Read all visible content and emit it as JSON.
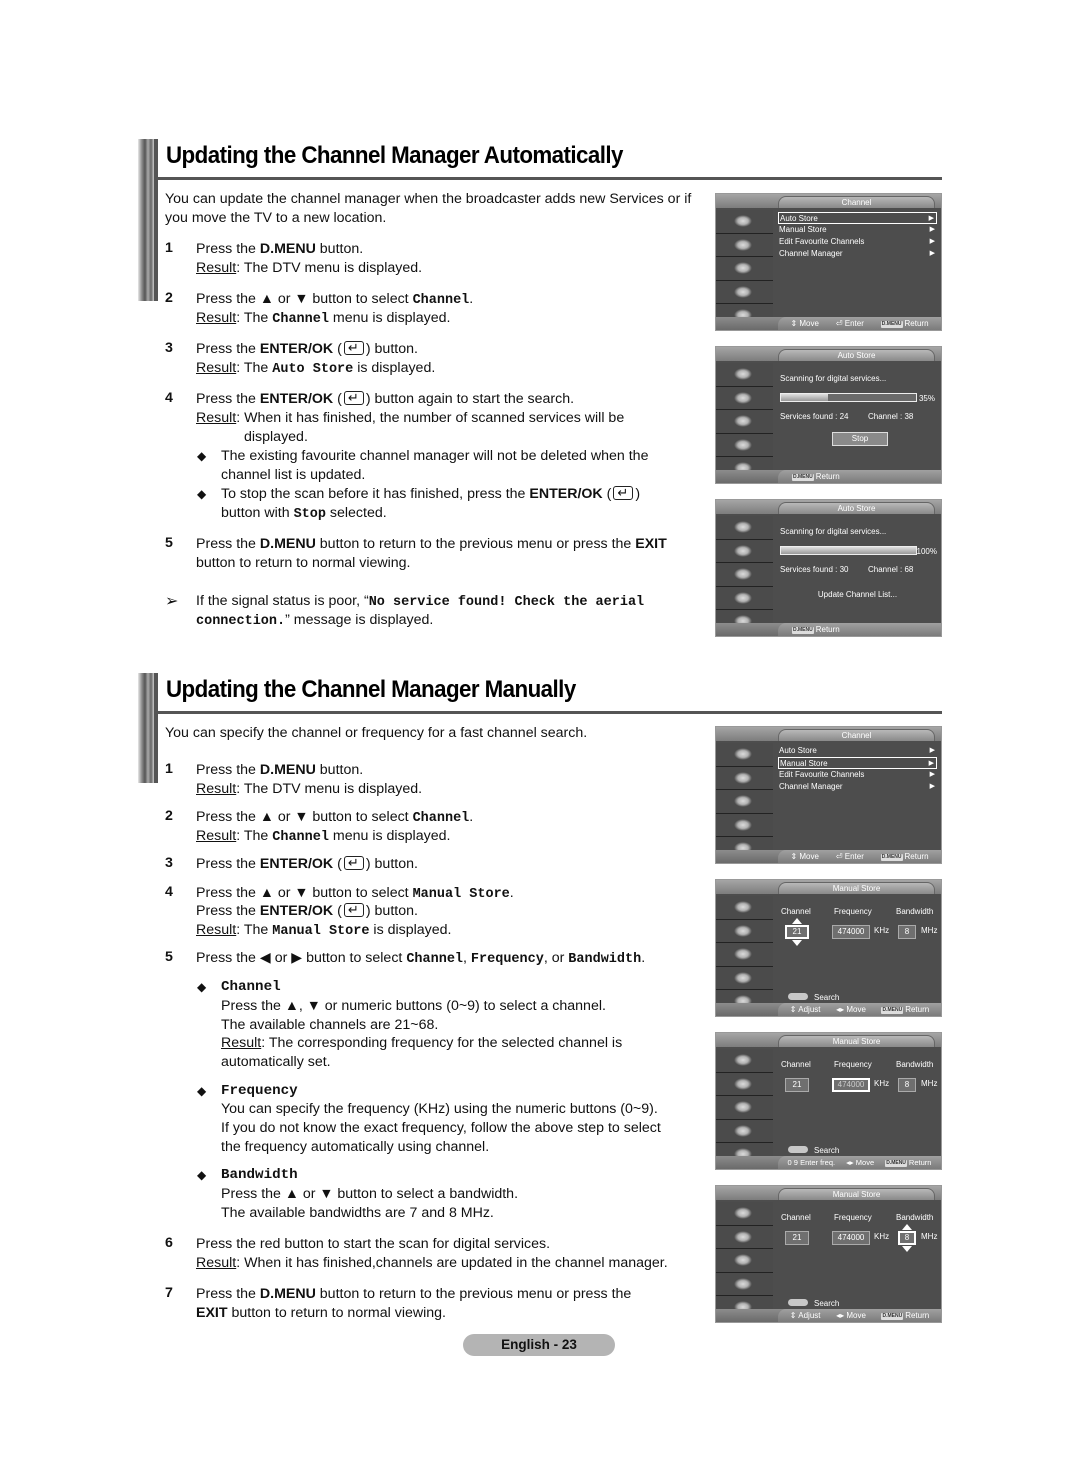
{
  "section1": {
    "title": "Updating the Channel Manager Automatically",
    "intro": "You can update the channel manager when the broadcaster adds new Services or if you move the TV to a new location.",
    "steps": [
      {
        "num": "1",
        "pre": "Press the ",
        "bold": "D.MENU",
        "post": " button.",
        "result_label": "Result",
        "result": ": The DTV menu is displayed."
      },
      {
        "num": "2",
        "pre": "Press the ▲ or ▼ button to select ",
        "mono": "Channel",
        "post": ".",
        "result_label": "Result",
        "result_pre": ": The ",
        "result_mono": "Channel",
        "result_post": " menu is displayed."
      },
      {
        "num": "3",
        "pre": "Press the ",
        "bold": "ENTER/OK",
        "post": " button.",
        "result_label": "Result",
        "result_pre": ": The ",
        "result_mono": "Auto Store",
        "result_post": " is displayed."
      },
      {
        "num": "4",
        "pre": "Press the ",
        "bold": "ENTER/OK",
        "post": " button again to start the search.",
        "result_label": "Result",
        "result": ": When it has finished, the number of scanned services will be",
        "result_cont": "displayed."
      },
      {
        "num": "5",
        "pre": "Press the ",
        "bold": "D.MENU",
        "mid": " button to return to the previous menu or press the ",
        "bold2": "EXIT",
        "post": " button  to return to normal viewing."
      }
    ],
    "bullets": [
      {
        "line1": "The existing favourite channel manager will not be deleted when the",
        "line2": "channel list is updated."
      },
      {
        "pre": "To stop the scan before it has finished, press the ",
        "bold": "ENTER/OK",
        "line2_pre": "button with ",
        "line2_mono": "Stop",
        "line2_post": " selected."
      }
    ],
    "note": {
      "pre": "If the signal status is poor, “",
      "mono1": "No service found!  Check the aerial",
      "mono2": "connection.",
      "post": "” message is displayed."
    }
  },
  "section2": {
    "title": "Updating the Channel Manager Manually",
    "intro": "You can specify the channel or frequency for a fast channel search.",
    "steps": [
      {
        "num": "1",
        "pre": "Press the ",
        "bold": "D.MENU",
        "post": " button.",
        "result_label": "Result",
        "result": ": The DTV menu is displayed."
      },
      {
        "num": "2",
        "pre": "Press the ▲ or ▼ button to select ",
        "mono": "Channel",
        "post": ".",
        "result_label": "Result",
        "result_pre": ": The ",
        "result_mono": "Channel",
        "result_post": " menu is displayed."
      },
      {
        "num": "3",
        "pre": "Press the ",
        "bold": "ENTER/OK",
        "post": " button."
      },
      {
        "num": "4",
        "pre": "Press the ▲ or ▼ button to select ",
        "mono": "Manual Store",
        "post": ".",
        "line2_pre": "Press the ",
        "line2_bold": "ENTER/OK",
        "line2_post": " button.",
        "result_label": "Result",
        "result_pre": ": The ",
        "result_mono": "Manual Store",
        "result_post": " is displayed."
      },
      {
        "num": "5",
        "pre": "Press the ◀ or ▶ button to select ",
        "mono1": "Channel",
        "sep1": ", ",
        "mono2": "Frequency",
        "sep2": ", or ",
        "mono3": "Bandwidth",
        "post": "."
      },
      {
        "num": "6",
        "text": "Press the red button to start the scan for digital services.",
        "result_label": "Result",
        "result": ": When it has finished,channels are updated in the channel manager."
      },
      {
        "num": "7",
        "pre": "Press the ",
        "bold": "D.MENU",
        "post": " button to return to the previous menu or press the",
        "line2_bold": "EXIT",
        "line2_post": " button to return to normal viewing."
      }
    ],
    "options": [
      {
        "name": "Channel",
        "lines": [
          "Press the ▲, ▼ or numeric buttons (0~9) to select a channel.",
          "The available channels are 21~68."
        ],
        "result_label": "Result",
        "result": ": The corresponding frequency for the selected channel is",
        "result_cont": "automatically set."
      },
      {
        "name": "Frequency",
        "lines": [
          "You can specify the frequency (KHz) using the numeric buttons (0~9).",
          "If you do not know the exact frequency, follow the above step to select",
          "the frequency automatically using channel."
        ]
      },
      {
        "name": "Bandwidth",
        "lines": [
          "Press the ▲ or ▼ button to select a bandwidth.",
          "The available bandwidths are 7 and 8 MHz."
        ]
      }
    ]
  },
  "osd": {
    "channel_menu": {
      "title": "Channel",
      "items": [
        "Auto Store",
        "Manual Store",
        "Edit Favourite Channels",
        "Channel Manager"
      ],
      "footer": {
        "move": "Move",
        "enter": "Enter",
        "dmenu": "D.MENU",
        "return": "Return"
      }
    },
    "auto_store_1": {
      "title": "Auto Store",
      "scanning": "Scanning for digital services...",
      "progress_pct": 35,
      "progress_label": "35%",
      "services": "Services found : 24",
      "channel": "Channel : 38",
      "stop": "Stop",
      "dmenu": "D.MENU",
      "return": "Return"
    },
    "auto_store_2": {
      "title": "Auto Store",
      "scanning": "Scanning for digital services...",
      "progress_pct": 100,
      "progress_label": "100%",
      "services": "Services found : 30",
      "channel": "Channel : 68",
      "update": "Update Channel List...",
      "dmenu": "D.MENU",
      "return": "Return"
    },
    "manual_store": {
      "title": "Manual Store",
      "labels": {
        "channel": "Channel",
        "frequency": "Frequency",
        "bandwidth": "Bandwidth"
      },
      "values": {
        "channel": "21",
        "frequency": "474000",
        "bandwidth": "8"
      },
      "units": {
        "frequency": "KHz",
        "bandwidth": "MHz"
      },
      "search": "Search",
      "footer_adjust": {
        "adjust": "Adjust",
        "move": "Move",
        "dmenu": "D.MENU",
        "return": "Return"
      },
      "footer_freq": {
        "keys": "0 9",
        "enter": "Enter freq.",
        "move": "Move",
        "dmenu": "D.MENU",
        "return": "Return"
      }
    }
  },
  "footer": {
    "page": "English - 23"
  }
}
